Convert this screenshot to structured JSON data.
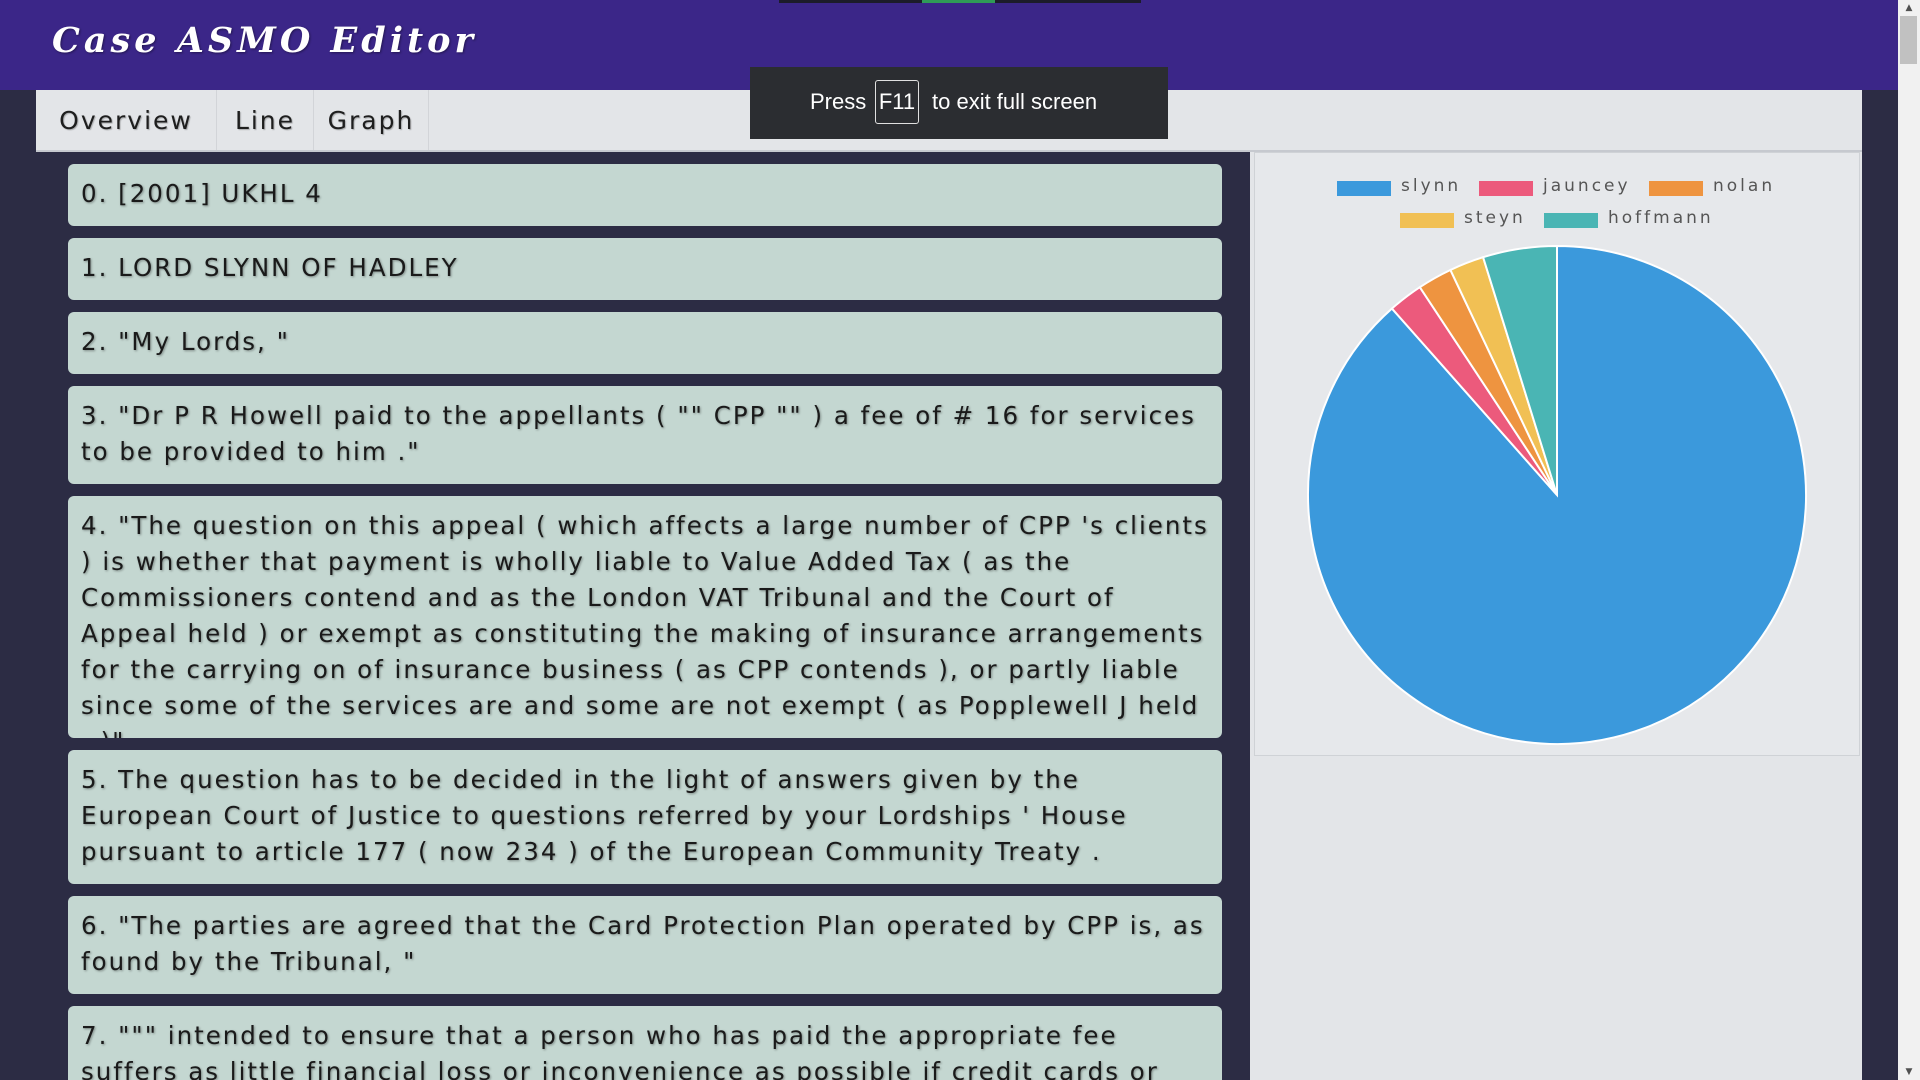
{
  "app": {
    "title": "Case ASMO Editor"
  },
  "tabs": [
    {
      "label": "Overview"
    },
    {
      "label": "Line"
    },
    {
      "label": "Graph"
    }
  ],
  "lines": [
    {
      "text": "0. [2001] UKHL 4"
    },
    {
      "text": "1. LORD SLYNN OF HADLEY"
    },
    {
      "text": "2. \"My Lords, \""
    },
    {
      "text": "3. \"Dr P R Howell paid to the appellants ( \"\" CPP \"\" ) a fee of # 16 for services to be provided to him .\""
    },
    {
      "text": "4. \"The question on this appeal ( which affects a large number of CPP 's clients ) is whether that payment is wholly liable to Value Added Tax ( as the Commissioners contend and as the London VAT Tribunal and the Court of Appeal held ) or exempt as constituting the making of insurance arrangements for the carrying on of insurance business ( as CPP contends ), or partly liable since some of the services are and some are not exempt ( as Popplewell J held . )\""
    },
    {
      "text": "5. The question has to be decided in the light of answers given by the European Court of Justice to questions referred by your Lordships ' House pursuant to article 177 ( now 234 ) of the European Community Treaty ."
    },
    {
      "text": "6. \"The parties are agreed that the Card Protection Plan operated by CPP is, as found by the Tribunal, \""
    },
    {
      "text": "7. \"\"\" intended to ensure that a person who has paid the appropriate fee suffers as little financial loss or inconvenience as possible if credit cards or certain"
    }
  ],
  "fullscreen_notice": {
    "prefix": "Press",
    "key": "F11",
    "suffix": "to exit full screen"
  },
  "chart_data": {
    "type": "pie",
    "legend_position": "top",
    "labels": [
      "slynn",
      "jauncey",
      "nolan",
      "steyn",
      "hoffmann"
    ],
    "values": [
      86.7,
      2.2,
      2.2,
      2.2,
      4.7
    ],
    "colors": [
      "#3b99dc",
      "#ec5a7c",
      "#ee9440",
      "#f1c054",
      "#4ab5b4"
    ]
  }
}
